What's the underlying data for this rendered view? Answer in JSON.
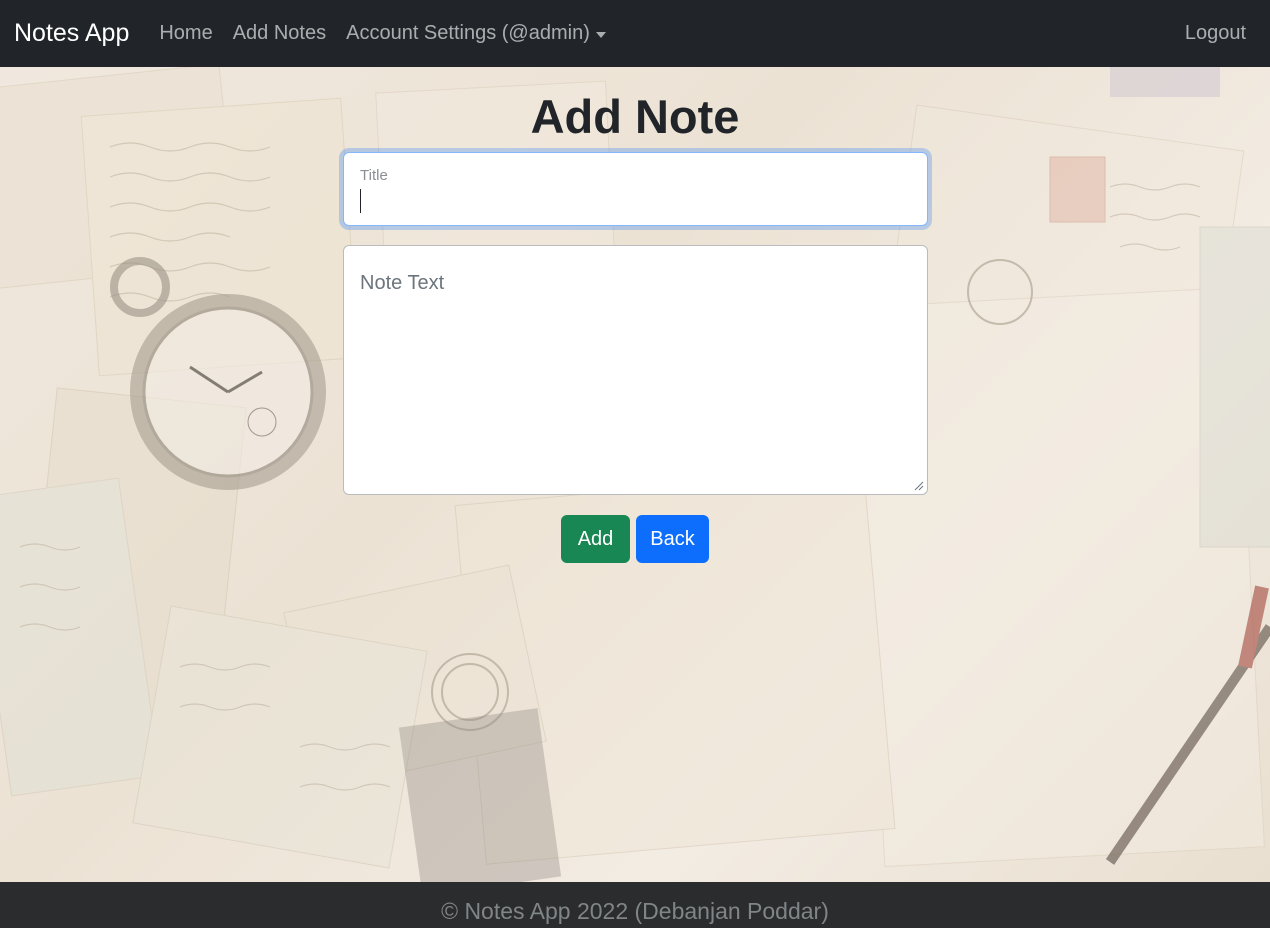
{
  "navbar": {
    "brand": "Notes App",
    "links": [
      {
        "label": "Home"
      },
      {
        "label": "Add Notes"
      },
      {
        "label": "Account Settings (@admin)"
      }
    ],
    "logout": "Logout"
  },
  "page": {
    "title": "Add Note"
  },
  "form": {
    "title_label": "Title",
    "note_placeholder": "Note Text",
    "add_button": "Add",
    "back_button": "Back"
  },
  "footer": {
    "text": "© Notes App 2022 (Debanjan Poddar)"
  },
  "colors": {
    "navbar": "#212529",
    "add_button": "#198754",
    "back_button": "#0d6efd",
    "focus_border": "#86b7fe"
  }
}
